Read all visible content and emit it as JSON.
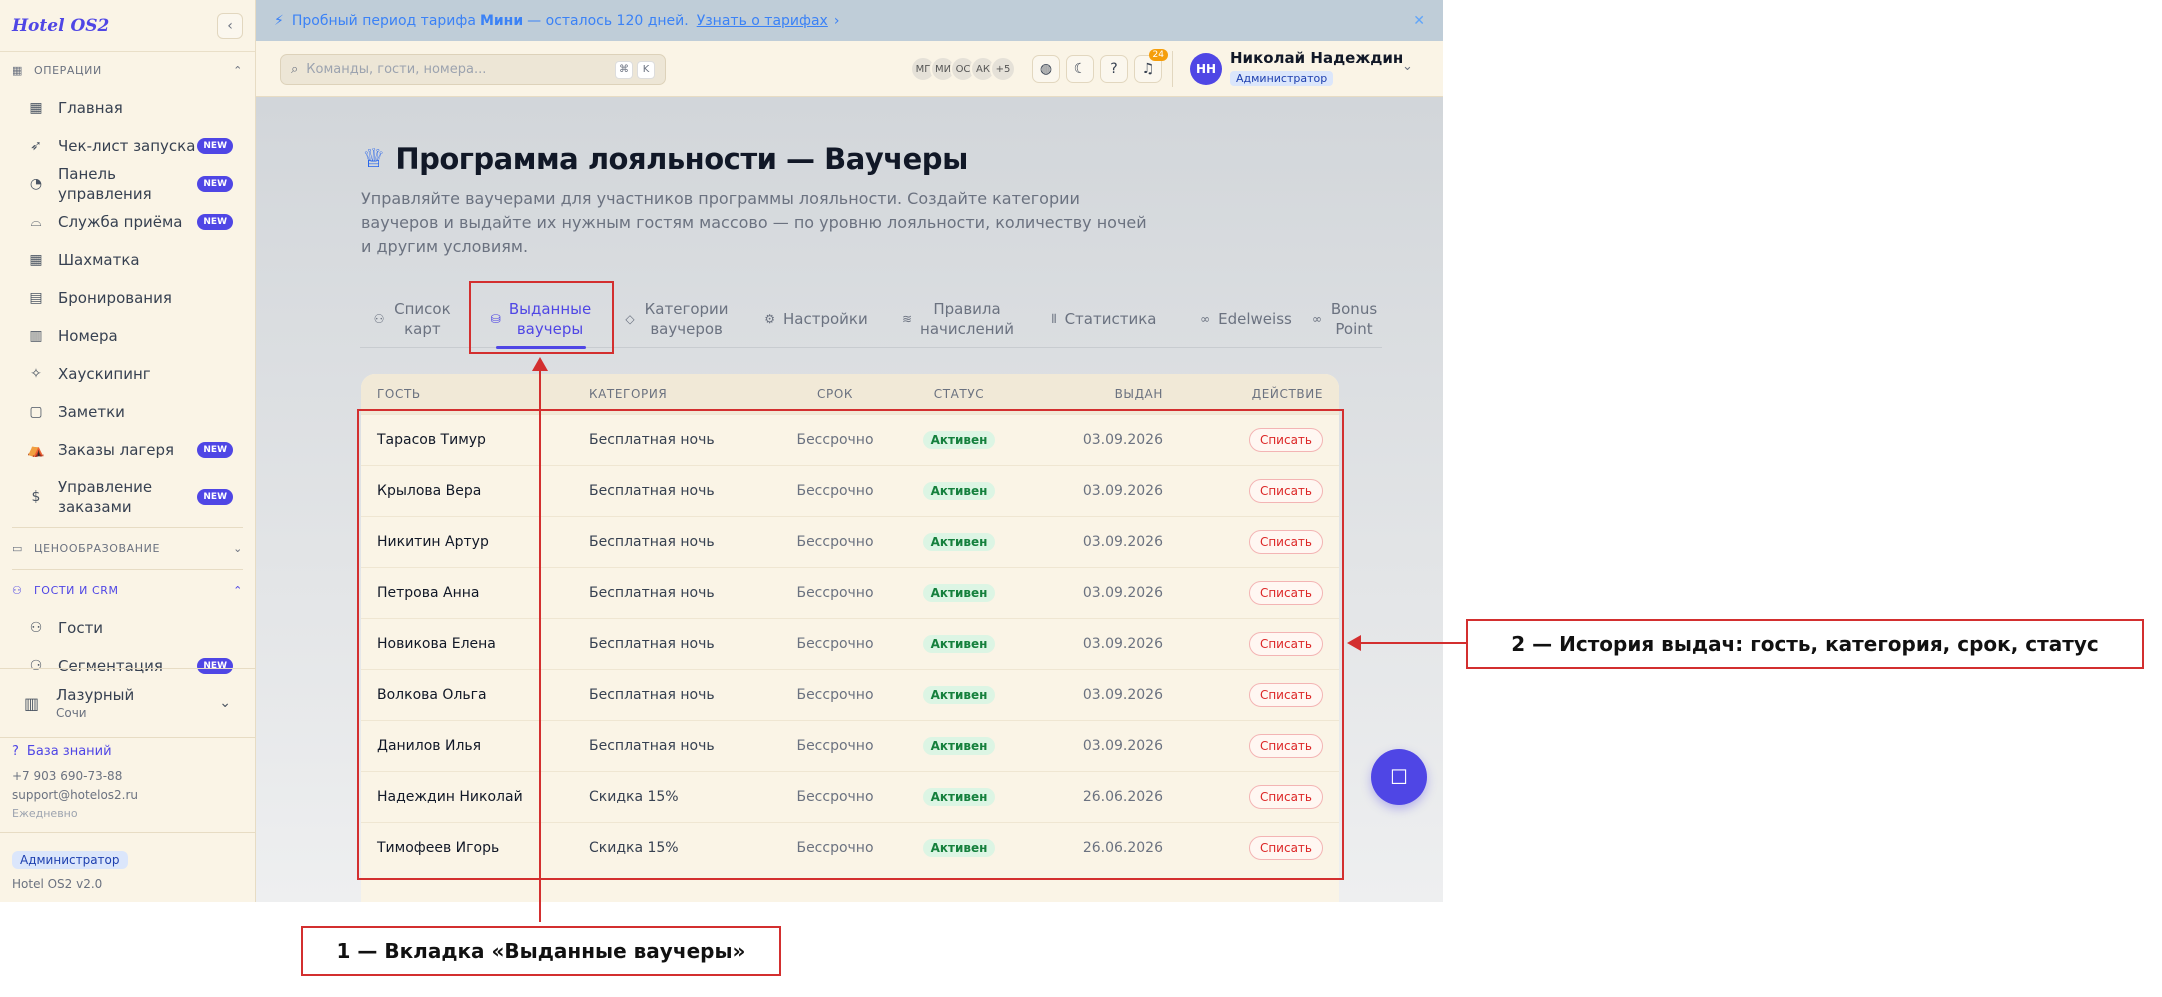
{
  "app": {
    "brand": "Hotel OS2"
  },
  "sidebar": {
    "sections": {
      "operations": "ОПЕРАЦИИ",
      "pricing": "ЦЕНООБРАЗОВАНИЕ",
      "guests_crm": "ГОСТИ И CRM"
    },
    "items": [
      {
        "label": "Главная",
        "icon": "dashboard-icon"
      },
      {
        "label": "Чек-лист запуска",
        "icon": "rocket-icon",
        "badge": "NEW"
      },
      {
        "label": "Панель управления",
        "icon": "gauge-icon",
        "badge": "NEW"
      },
      {
        "label": "Служба приёма",
        "icon": "bell-desk-icon",
        "badge": "NEW"
      },
      {
        "label": "Шахматка",
        "icon": "grid-icon"
      },
      {
        "label": "Бронирования",
        "icon": "clipboard-icon"
      },
      {
        "label": "Номера",
        "icon": "building-icon"
      },
      {
        "label": "Хаускипинг",
        "icon": "sparkle-icon"
      },
      {
        "label": "Заметки",
        "icon": "note-icon"
      },
      {
        "label": "Заказы лагеря",
        "icon": "tent-icon",
        "badge": "NEW"
      },
      {
        "label": "Управление заказами",
        "icon": "dollar-doc-icon",
        "badge": "NEW"
      },
      {
        "label": "Гости",
        "icon": "users-icon"
      },
      {
        "label": "Сегментация",
        "icon": "segments-icon",
        "badge": "NEW"
      }
    ],
    "hotel": {
      "name": "Лазурный",
      "city": "Сочи"
    },
    "contacts": {
      "knowledge_base": "База знаний",
      "phone": "+7 903 690-73-88",
      "email": "support@hotelos2.ru",
      "schedule": "Ежедневно"
    },
    "footer": {
      "role": "Администратор",
      "version": "Hotel OS2 v2.0"
    }
  },
  "banner": {
    "text_prefix": "Пробный период тарифа",
    "plan": "Мини",
    "text_suffix": "— осталось 120 дней.",
    "link": "Узнать о тарифах",
    "link_chevron": "›"
  },
  "topbar": {
    "search_placeholder": "Команды, гости, номера...",
    "kbd": [
      "⌘",
      "K"
    ],
    "presence": [
      "МГ",
      "МИ",
      "ОС",
      "АК",
      "+5"
    ],
    "notifications_count": "24",
    "user": {
      "initials": "НН",
      "name": "Николай Надеждин",
      "role": "Администратор"
    }
  },
  "page": {
    "title": "Программа лояльности — Ваучеры",
    "description": "Управляйте ваучерами для участников программы лояльности. Создайте категории ваучеров и выдайте их нужным гостям массово — по уровню лояльности, количеству ночей и другим условиям."
  },
  "tabs": [
    {
      "label": "Список карт",
      "icon": "cards-icon"
    },
    {
      "label": "Выданные ваучеры",
      "icon": "ticket-icon",
      "active": true
    },
    {
      "label": "Категории ваучеров",
      "icon": "tag-icon"
    },
    {
      "label": "Настройки",
      "icon": "gear-icon"
    },
    {
      "label": "Правила начислений",
      "icon": "layers-icon"
    },
    {
      "label": "Статистика",
      "icon": "bars-icon"
    },
    {
      "label": "Edelweiss",
      "icon": "link-icon"
    },
    {
      "label": "Bonus Point",
      "icon": "link-icon"
    }
  ],
  "table": {
    "columns": {
      "guest": "ГОСТЬ",
      "category": "КАТЕГОРИЯ",
      "term": "СРОК",
      "status": "СТАТУС",
      "issued": "ВЫДАН",
      "action": "ДЕЙСТВИЕ"
    },
    "rows": [
      {
        "guest": "Тарасов Тимур",
        "category": "Бесплатная ночь",
        "term": "Бессрочно",
        "status": "Активен",
        "issued": "03.09.2026",
        "action": "Списать"
      },
      {
        "guest": "Крылова Вера",
        "category": "Бесплатная ночь",
        "term": "Бессрочно",
        "status": "Активен",
        "issued": "03.09.2026",
        "action": "Списать"
      },
      {
        "guest": "Никитин Артур",
        "category": "Бесплатная ночь",
        "term": "Бессрочно",
        "status": "Активен",
        "issued": "03.09.2026",
        "action": "Списать"
      },
      {
        "guest": "Петрова Анна",
        "category": "Бесплатная ночь",
        "term": "Бессрочно",
        "status": "Активен",
        "issued": "03.09.2026",
        "action": "Списать"
      },
      {
        "guest": "Новикова Елена",
        "category": "Бесплатная ночь",
        "term": "Бессрочно",
        "status": "Активен",
        "issued": "03.09.2026",
        "action": "Списать"
      },
      {
        "guest": "Волкова Ольга",
        "category": "Бесплатная ночь",
        "term": "Бессрочно",
        "status": "Активен",
        "issued": "03.09.2026",
        "action": "Списать"
      },
      {
        "guest": "Данилов Илья",
        "category": "Бесплатная ночь",
        "term": "Бессрочно",
        "status": "Активен",
        "issued": "03.09.2026",
        "action": "Списать"
      },
      {
        "guest": "Надеждин Николай",
        "category": "Скидка 15%",
        "term": "Бессрочно",
        "status": "Активен",
        "issued": "26.06.2026",
        "action": "Списать"
      },
      {
        "guest": "Тимофеев Игорь",
        "category": "Скидка 15%",
        "term": "Бессрочно",
        "status": "Активен",
        "issued": "26.06.2026",
        "action": "Списать"
      }
    ]
  },
  "annotations": {
    "label1": "1 — Вкладка «Выданные ваучеры»",
    "label2": "2 — История выдач: гость, категория, срок, статус"
  },
  "colors": {
    "accent": "#4f46e5",
    "annotation": "#d32f2f",
    "status_active": "#15803d",
    "danger": "#dc2626"
  }
}
